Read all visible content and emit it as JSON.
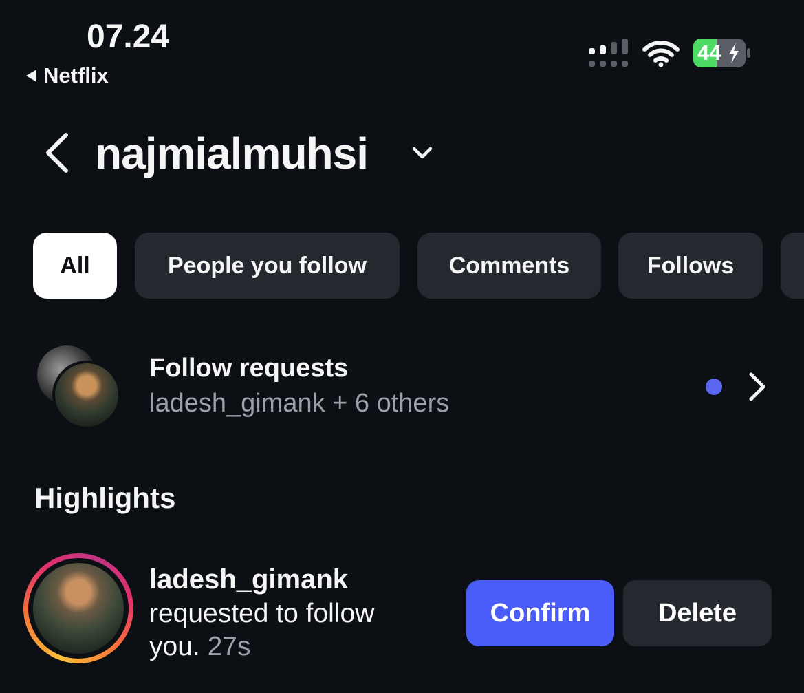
{
  "status_bar": {
    "time": "07.24",
    "back_app": "Netflix",
    "battery": "44",
    "battery_color": "#4cd964"
  },
  "header": {
    "title": "najmialmuhsi"
  },
  "tabs": [
    {
      "label": "All",
      "active": true
    },
    {
      "label": "People you follow",
      "active": false
    },
    {
      "label": "Comments",
      "active": false
    },
    {
      "label": "Follows",
      "active": false
    }
  ],
  "follow_requests": {
    "title": "Follow requests",
    "subtitle": "ladesh_gimank + 6 others",
    "unread_dot_color": "#5b67f0"
  },
  "highlights": {
    "heading": "Highlights",
    "items": [
      {
        "username": "ladesh_gimank",
        "text_line1": "requested to follow",
        "text_line2": "you.",
        "time": "27s",
        "confirm_label": "Confirm",
        "delete_label": "Delete"
      }
    ]
  },
  "colors": {
    "background": "#0c0f14",
    "chip": "#25292f",
    "accent": "#4a5df9"
  }
}
